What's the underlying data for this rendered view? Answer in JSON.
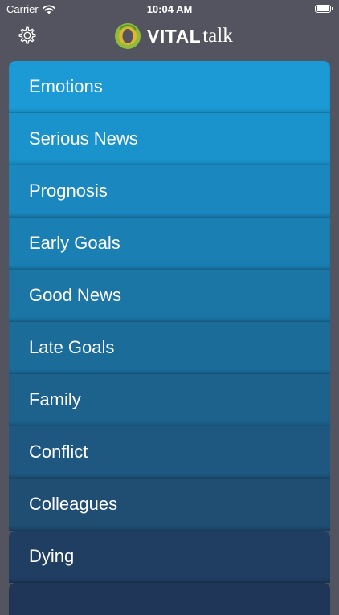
{
  "status_bar": {
    "carrier": "Carrier",
    "time": "10:04 AM",
    "wifi_icon": "wifi-icon",
    "battery_icon": "battery-icon"
  },
  "nav": {
    "settings_icon": "gear-icon",
    "logo": {
      "brand_strong": "VITAL",
      "brand_light": "talk",
      "accent_green": "#8dbd3a",
      "accent_yellow": "#e8b32a"
    }
  },
  "menu": {
    "items": [
      {
        "label": "Emotions",
        "color": "#1b9ad5"
      },
      {
        "label": "Serious News",
        "color": "#1a92cb"
      },
      {
        "label": "Prognosis",
        "color": "#1a88be"
      },
      {
        "label": "Early Goals",
        "color": "#1a7fb2"
      },
      {
        "label": "Good News",
        "color": "#1b76a6"
      },
      {
        "label": "Late Goals",
        "color": "#1c6c9a"
      },
      {
        "label": "Family",
        "color": "#1d628d"
      },
      {
        "label": "Conflict",
        "color": "#1e5880"
      },
      {
        "label": "Colleagues",
        "color": "#1f4e72"
      },
      {
        "label": "Dying",
        "color": "#1f3e62"
      },
      {
        "label": "",
        "color": "#203659"
      }
    ]
  },
  "colors": {
    "background": "#545461",
    "text": "#ffffff"
  }
}
